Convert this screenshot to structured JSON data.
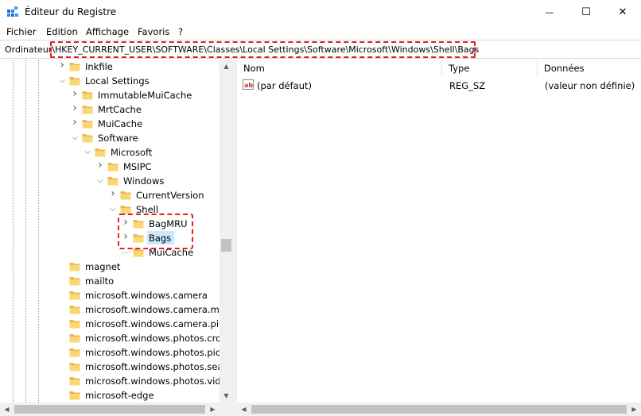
{
  "window": {
    "title": "Éditeur du Registre",
    "icon": "registry-editor-icon",
    "minimize_glyph": "—",
    "maximize_glyph": "☐",
    "close_glyph": "✕"
  },
  "menu": {
    "items": [
      "Fichier",
      "Edition",
      "Affichage",
      "Favoris",
      "?"
    ]
  },
  "address": {
    "label": "Ordinateur",
    "path": "\\HKEY_CURRENT_USER\\SOFTWARE\\Classes\\Local Settings\\Software\\Microsoft\\Windows\\Shell\\Bags"
  },
  "tree": {
    "nodes": [
      {
        "label": "Inkfile",
        "depth": 0,
        "state": "collapsed"
      },
      {
        "label": "Local Settings",
        "depth": 0,
        "state": "expanded"
      },
      {
        "label": "ImmutableMuiCache",
        "depth": 1,
        "state": "collapsed"
      },
      {
        "label": "MrtCache",
        "depth": 1,
        "state": "collapsed"
      },
      {
        "label": "MuiCache",
        "depth": 1,
        "state": "collapsed"
      },
      {
        "label": "Software",
        "depth": 1,
        "state": "expanded"
      },
      {
        "label": "Microsoft",
        "depth": 2,
        "state": "expanded"
      },
      {
        "label": "MSIPC",
        "depth": 3,
        "state": "collapsed"
      },
      {
        "label": "Windows",
        "depth": 3,
        "state": "expanded"
      },
      {
        "label": "CurrentVersion",
        "depth": 4,
        "state": "collapsed"
      },
      {
        "label": "Shell",
        "depth": 4,
        "state": "expanded"
      },
      {
        "label": "BagMRU",
        "depth": 5,
        "state": "collapsed"
      },
      {
        "label": "Bags",
        "depth": 5,
        "state": "collapsed",
        "selected": true
      },
      {
        "label": "MuiCache",
        "depth": 5,
        "state": "leaf"
      },
      {
        "label": "magnet",
        "depth": 0,
        "state": "leaf"
      },
      {
        "label": "mailto",
        "depth": 0,
        "state": "leaf"
      },
      {
        "label": "microsoft.windows.camera",
        "depth": 0,
        "state": "leaf"
      },
      {
        "label": "microsoft.windows.camera.mul",
        "depth": 0,
        "state": "leaf"
      },
      {
        "label": "microsoft.windows.camera.pick",
        "depth": 0,
        "state": "leaf"
      },
      {
        "label": "microsoft.windows.photos.crop",
        "depth": 0,
        "state": "leaf"
      },
      {
        "label": "microsoft.windows.photos.pick",
        "depth": 0,
        "state": "leaf"
      },
      {
        "label": "microsoft.windows.photos.searc",
        "depth": 0,
        "state": "leaf"
      },
      {
        "label": "microsoft.windows.photos.vide",
        "depth": 0,
        "state": "leaf"
      },
      {
        "label": "microsoft-edge",
        "depth": 0,
        "state": "leaf"
      }
    ]
  },
  "list": {
    "columns": [
      "Nom",
      "Type",
      "Données"
    ],
    "rows": [
      {
        "name": "(par défaut)",
        "type": "REG_SZ",
        "data": "(valeur non définie)",
        "icon": "string-value-icon"
      }
    ]
  },
  "colors": {
    "highlight": "#e02020",
    "selection": "#cce8ff",
    "folder": "#f8d775"
  }
}
